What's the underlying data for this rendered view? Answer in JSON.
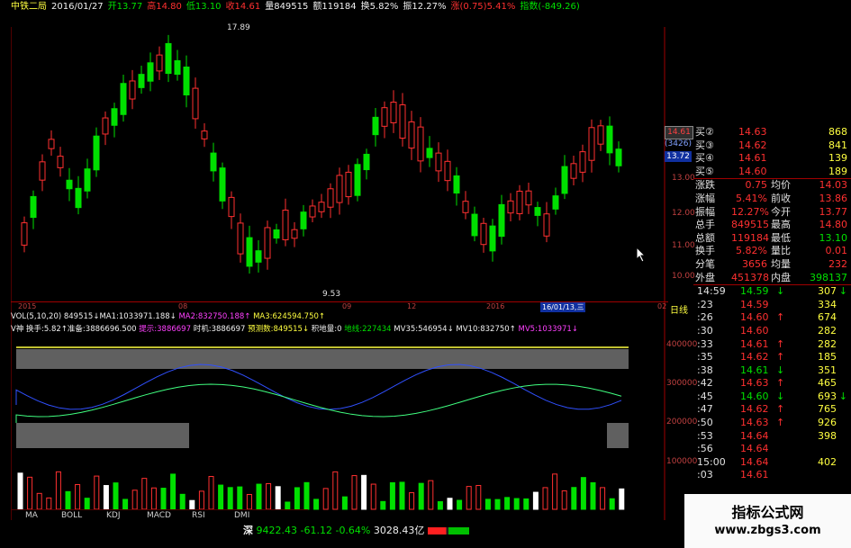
{
  "header": {
    "name": "中铁二局",
    "date": "2016/01/27",
    "open": "开13.77",
    "high": "高14.80",
    "low": "低13.10",
    "close": "收14.61",
    "volume": "量849515",
    "amount": "额119184",
    "turnover": "换5.82%",
    "amplitude": "振12.27%",
    "change": "涨(0.75)5.41%",
    "index": "指数(-849.26)"
  },
  "price_chart": {
    "high_label": "17.89",
    "low_label": "9.53",
    "y_ticks": [
      "13.00",
      "12.00",
      "11.00",
      "10.00"
    ],
    "right_box_values": [
      "14.61",
      "(3426)",
      "13.72"
    ],
    "x_ticks": [
      "2015",
      "08",
      "09",
      "12",
      "2016",
      "02"
    ],
    "date_cursor": "16/01/13,三",
    "period_label": "日线"
  },
  "vol_info": {
    "label": "VOL(5,10,20) 849515↓MA1:1033971.188↓",
    "ma2": "MA2:832750.188↑",
    "ma3": "MA3:624594.750↑"
  },
  "indicator_info": {
    "label": "V神 换手:5.82↑准备:3886696.500",
    "tip": "提示:3886697",
    "timing": "时机:3886697",
    "forecast": "预测数:849515↓",
    "accumulate": "积地量:0",
    "ground": "地线:227434",
    "mv35": "MV35:546954↓",
    "mv10": "MV10:832750↑",
    "mv5": "MV5:1033971↓"
  },
  "indicator_y_ticks": [
    "400000",
    "300000",
    "200000",
    "100000"
  ],
  "bottom_tabs": [
    "MA",
    "BOLL",
    "KDJ",
    "MACD",
    "RSI",
    "DMI"
  ],
  "quote_panel": {
    "bids": [
      {
        "label": "买②",
        "price": "14.63",
        "vol": "868"
      },
      {
        "label": "买③",
        "price": "14.62",
        "vol": "841"
      },
      {
        "label": "买④",
        "price": "14.61",
        "vol": "139"
      },
      {
        "label": "买⑤",
        "price": "14.60",
        "vol": "189"
      }
    ],
    "stats": [
      {
        "l1": "涨跌",
        "v1": "0.75",
        "l2": "均价",
        "v2": "14.03"
      },
      {
        "l1": "涨幅",
        "v1": "5.41%",
        "l2": "前收",
        "v2": "13.86"
      },
      {
        "l1": "振幅",
        "v1": "12.27%",
        "l2": "今开",
        "v2": "13.77"
      },
      {
        "l1": "总手",
        "v1": "849515",
        "l2": "最高",
        "v2": "14.80"
      },
      {
        "l1": "总额",
        "v1": "119184",
        "l2": "最低",
        "v2": "13.10"
      },
      {
        "l1": "换手",
        "v1": "5.82%",
        "l2": "量比",
        "v2": "0.01"
      },
      {
        "l1": "分笔",
        "v1": "3656",
        "l2": "均量",
        "v2": "232"
      },
      {
        "l1": "外盘",
        "v1": "451378",
        "l2": "内盘",
        "v2": "398137"
      }
    ],
    "ticks": [
      {
        "time": "14:59",
        "price": "14.59",
        "dir": "↓",
        "vol": "307",
        "vdir": "↓"
      },
      {
        "time": ":23",
        "price": "14.59",
        "dir": "",
        "vol": "334",
        "vdir": ""
      },
      {
        "time": ":26",
        "price": "14.60",
        "dir": "↑",
        "vol": "674",
        "vdir": ""
      },
      {
        "time": ":30",
        "price": "14.60",
        "dir": "",
        "vol": "282",
        "vdir": ""
      },
      {
        "time": ":33",
        "price": "14.61",
        "dir": "↑",
        "vol": "282",
        "vdir": ""
      },
      {
        "time": ":35",
        "price": "14.62",
        "dir": "↑",
        "vol": "185",
        "vdir": ""
      },
      {
        "time": ":38",
        "price": "14.61",
        "dir": "↓",
        "vol": "351",
        "vdir": ""
      },
      {
        "time": ":42",
        "price": "14.63",
        "dir": "↑",
        "vol": "465",
        "vdir": ""
      },
      {
        "time": ":45",
        "price": "14.60",
        "dir": "↓",
        "vol": "693",
        "vdir": "↓"
      },
      {
        "time": ":47",
        "price": "14.62",
        "dir": "↑",
        "vol": "765",
        "vdir": ""
      },
      {
        "time": ":50",
        "price": "14.63",
        "dir": "↑",
        "vol": "926",
        "vdir": ""
      },
      {
        "time": ":53",
        "price": "14.64",
        "dir": "",
        "vol": "398",
        "vdir": ""
      },
      {
        "time": ":56",
        "price": "14.64",
        "dir": "",
        "vol": "",
        "vdir": ""
      },
      {
        "time": "15:00",
        "price": "14.64",
        "dir": "",
        "vol": "402",
        "vdir": ""
      },
      {
        "time": ":03",
        "price": "14.61",
        "dir": "",
        "vol": "",
        "vdir": ""
      }
    ]
  },
  "status_bar": {
    "market": "深",
    "index": "9422.43",
    "change": "-61.12",
    "pct": "-0.64%",
    "amount": "3028.43亿"
  },
  "watermark": {
    "title": "指标公式网",
    "url": "www.zbgs3.com"
  },
  "colors": {
    "up": "#ff3030",
    "down": "#00e000",
    "bg": "#000000"
  }
}
